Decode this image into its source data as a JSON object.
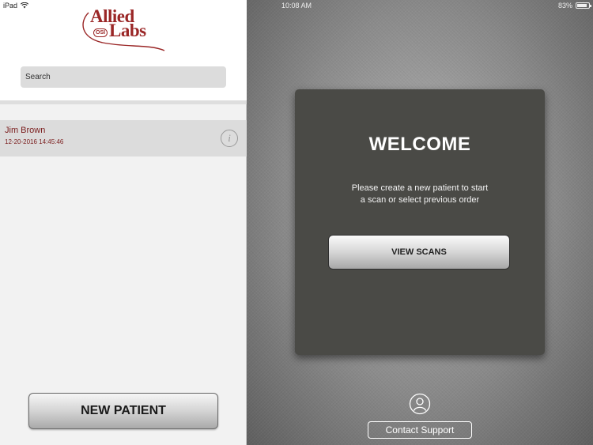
{
  "status_bar": {
    "device": "iPad",
    "time": "10:08 AM",
    "battery": "83%",
    "battery_level": 0.83
  },
  "logo": {
    "line1": "Allied",
    "line2": "Labs",
    "badge": "OSI"
  },
  "search": {
    "placeholder": "Search"
  },
  "patients": [
    {
      "name": "Jim Brown",
      "date": "12-20-2016 14:45:46"
    }
  ],
  "left_panel": {
    "new_patient_label": "NEW PATIENT"
  },
  "welcome": {
    "title": "WELCOME",
    "message_line1": "Please create a new patient to start",
    "message_line2": "a scan or select previous order",
    "view_scans_label": "VIEW SCANS"
  },
  "support": {
    "contact_label": "Contact Support"
  },
  "colors": {
    "brand": "#9a2626",
    "card": "#4a4a46"
  }
}
